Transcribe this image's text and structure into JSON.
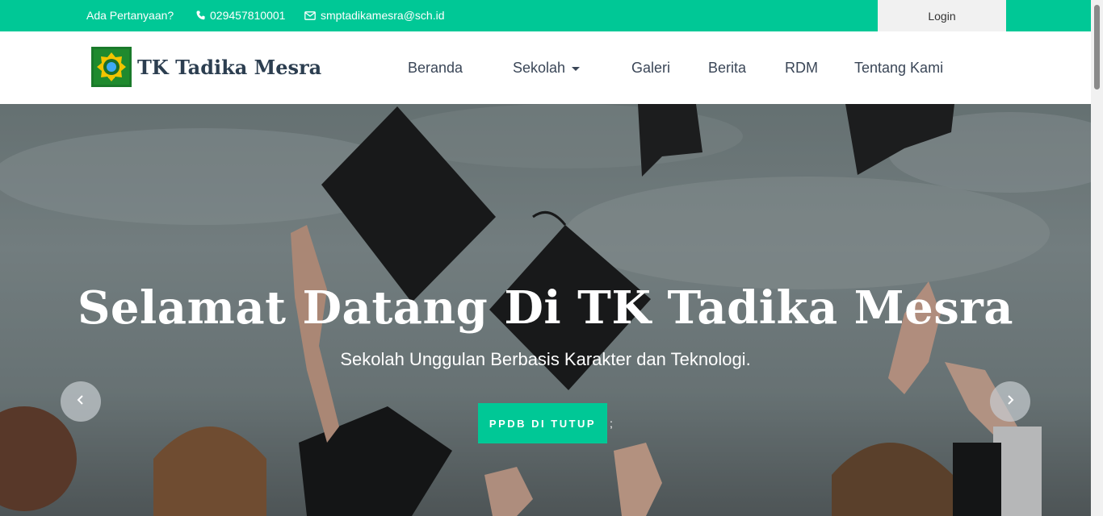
{
  "topbar": {
    "question": "Ada Pertanyaan?",
    "phone": "029457810001",
    "email": "smptadikamesra@sch.id",
    "login": "Login"
  },
  "brand": {
    "name": "TK Tadika Mesra"
  },
  "nav": {
    "items": [
      "Beranda",
      "Sekolah",
      "Galeri",
      "Berita",
      "RDM",
      "Tentang Kami"
    ]
  },
  "hero": {
    "title": "Selamat Datang Di TK Tadika Mesra",
    "subtitle": "Sekolah Unggulan Berbasis Karakter dan Teknologi.",
    "cta": "PPDB DI TUTUP",
    "trailing": ";"
  },
  "colors": {
    "accent": "#00c896",
    "nav_text": "#3a4657"
  },
  "icons": {
    "phone": "phone-icon",
    "email": "envelope-icon",
    "prev": "chevron-left-icon",
    "next": "chevron-right-icon"
  }
}
